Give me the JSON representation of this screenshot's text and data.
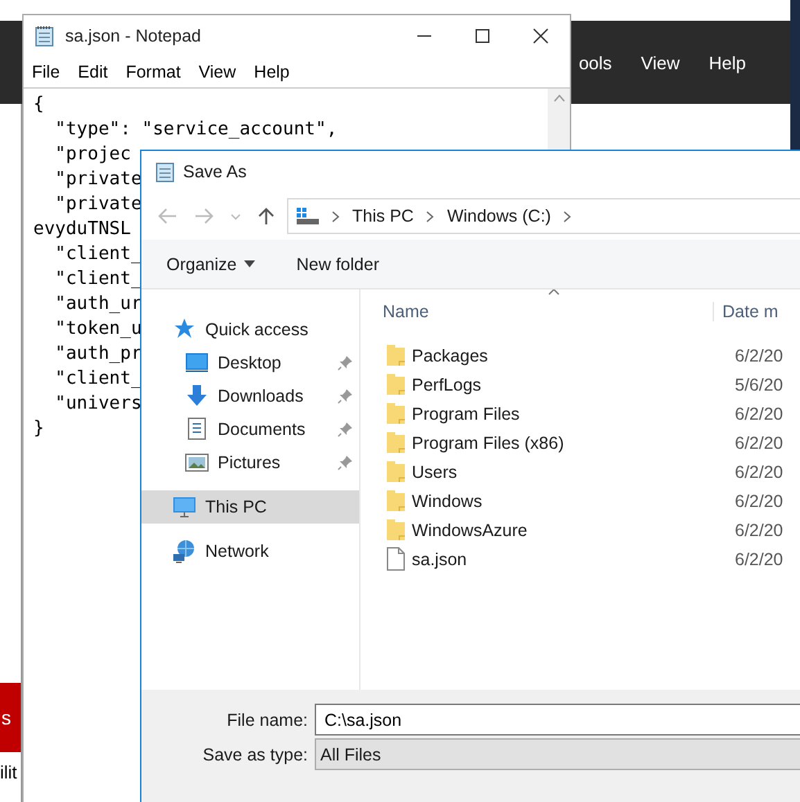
{
  "background_app": {
    "menu": [
      "ools",
      "View",
      "Help"
    ],
    "banner_text": "s",
    "footer_text": "ilit"
  },
  "notepad": {
    "title": "sa.json - Notepad",
    "menu": [
      "File",
      "Edit",
      "Format",
      "View",
      "Help"
    ],
    "lines": [
      "{",
      "  \"type\": \"service_account\",",
      "  \"projec",
      "  \"private",
      "  \"private",
      "evyduTNSL",
      "  \"client_",
      "  \"client_",
      "  \"auth_ur",
      "  \"token_u",
      "  \"auth_pr",
      "  \"client_",
      "  \"univers",
      "}"
    ]
  },
  "save_as": {
    "title": "Save As",
    "breadcrumb": [
      "This PC",
      "Windows (C:)"
    ],
    "toolbar": [
      "Organize",
      "New folder"
    ],
    "nav": [
      {
        "label": "Quick access",
        "kind": "star",
        "selected": false,
        "children": [
          {
            "label": "Desktop",
            "kind": "desktop",
            "selected": false,
            "pinned": true
          },
          {
            "label": "Downloads",
            "kind": "download",
            "selected": false,
            "pinned": true
          },
          {
            "label": "Documents",
            "kind": "document",
            "selected": false,
            "pinned": true
          },
          {
            "label": "Pictures",
            "kind": "pictures",
            "selected": false,
            "pinned": true
          }
        ]
      },
      {
        "label": "This PC",
        "kind": "pc",
        "selected": true
      },
      {
        "label": "Network",
        "kind": "network",
        "selected": false
      }
    ],
    "columns": [
      "Name",
      "Date m"
    ],
    "rows": [
      {
        "name": "Packages",
        "kind": "folder",
        "date": "6/2/20"
      },
      {
        "name": "PerfLogs",
        "kind": "folder",
        "date": "5/6/20"
      },
      {
        "name": "Program Files",
        "kind": "folder",
        "date": "6/2/20"
      },
      {
        "name": "Program Files (x86)",
        "kind": "folder",
        "date": "6/2/20"
      },
      {
        "name": "Users",
        "kind": "folder",
        "date": "6/2/20"
      },
      {
        "name": "Windows",
        "kind": "folder",
        "date": "6/2/20"
      },
      {
        "name": "WindowsAzure",
        "kind": "folder",
        "date": "6/2/20"
      },
      {
        "name": "sa.json",
        "kind": "file",
        "date": "6/2/20"
      }
    ],
    "file_name": {
      "label": "File name:",
      "value": "C:\\sa.json"
    },
    "save_type": {
      "label": "Save as type:",
      "value": "All Files"
    }
  }
}
